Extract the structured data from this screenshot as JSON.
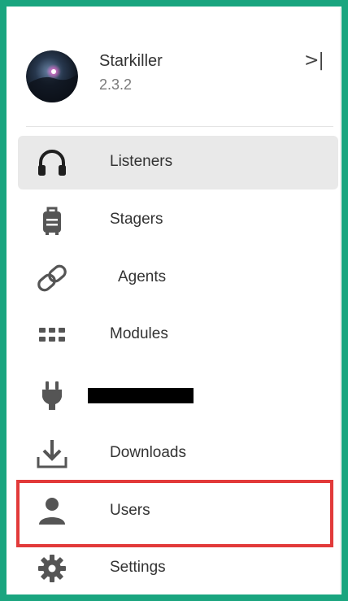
{
  "app": {
    "title": "Starkiller",
    "version": "2.3.2",
    "collapse_glyph": ">|"
  },
  "nav": {
    "items": [
      {
        "label": "Listeners",
        "icon": "headphones-icon",
        "active": true
      },
      {
        "label": "Stagers",
        "icon": "bag-icon"
      },
      {
        "label": "Agents",
        "icon": "link-icon"
      },
      {
        "label": "Modules",
        "icon": "grid-icon"
      },
      {
        "label": "",
        "icon": "plug-icon",
        "redacted": true
      },
      {
        "label": "Downloads",
        "icon": "download-icon"
      },
      {
        "label": "Users",
        "icon": "user-icon",
        "highlighted": true
      },
      {
        "label": "Settings",
        "icon": "gear-icon"
      }
    ]
  },
  "colors": {
    "frame": "#1aa57f",
    "active_bg": "#e9e9e9",
    "highlight": "#e23a3a",
    "icon": "#555555"
  }
}
